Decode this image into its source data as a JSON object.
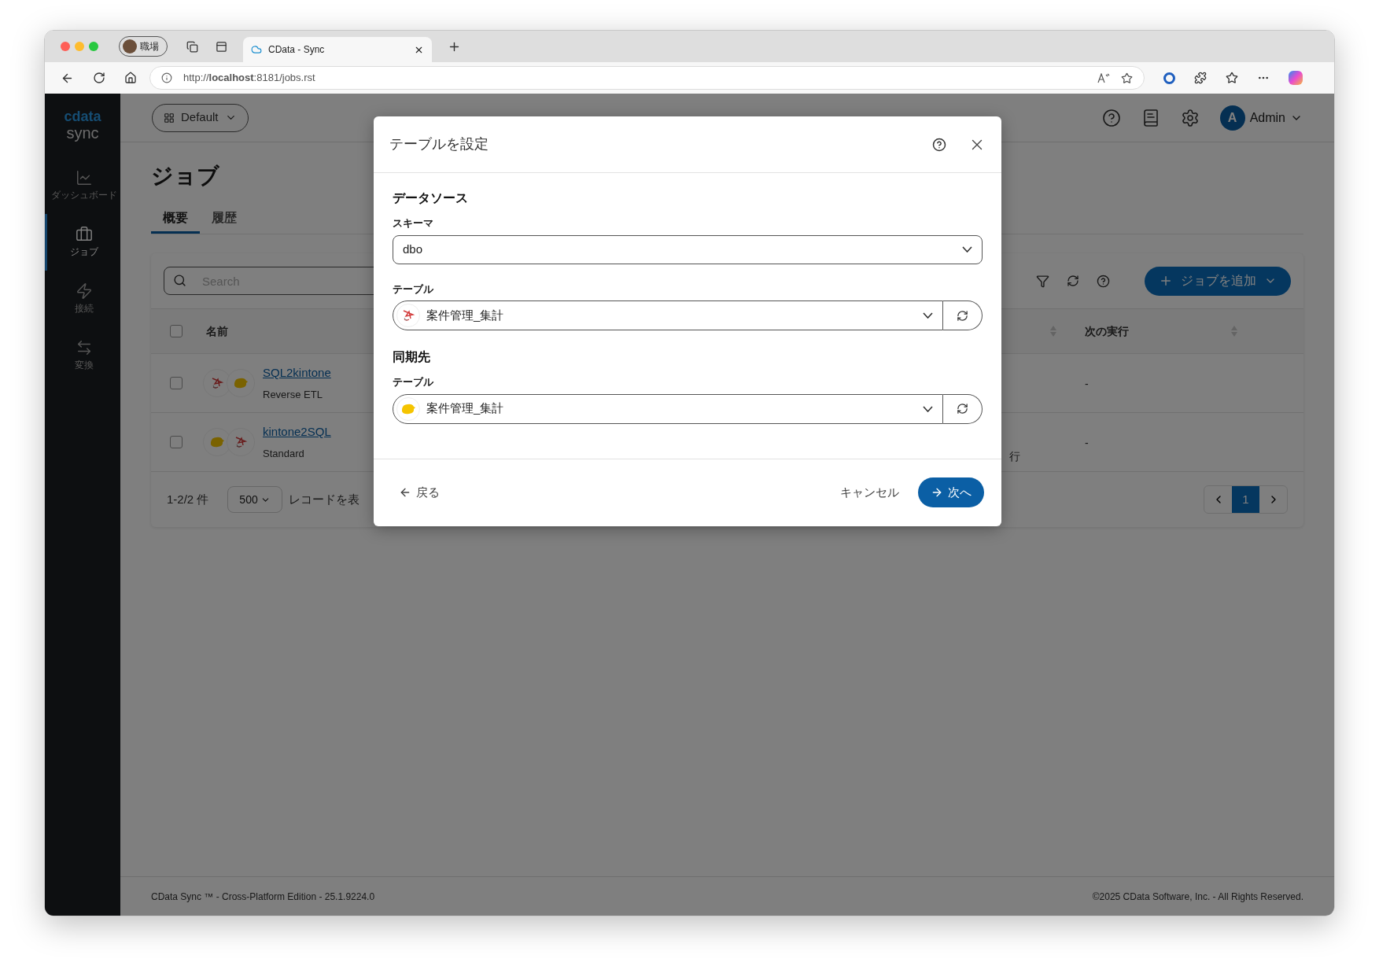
{
  "browser": {
    "profile": "職場",
    "tabs": [
      {
        "title": "CData - Sync",
        "selected": true
      }
    ],
    "url": "http://**localhost**:8181/jobs.rst"
  },
  "app": {
    "logo": {
      "brand": "cdata",
      "product": "sync"
    },
    "sidebar": {
      "items": [
        {
          "label": "ダッシュボード",
          "selected": false
        },
        {
          "label": "ジョブ",
          "selected": true
        },
        {
          "label": "接続",
          "selected": false
        },
        {
          "label": "変換",
          "selected": false
        }
      ]
    },
    "header": {
      "workspace": "Default",
      "user": {
        "initial": "A",
        "name": "Admin"
      }
    },
    "page": {
      "title": "ジョブ",
      "tabs": [
        {
          "label": "概要",
          "selected": true
        },
        {
          "label": "履歴",
          "selected": false
        }
      ],
      "search": {
        "placeholder": "Search"
      },
      "add_button": "ジョブを追加",
      "table": {
        "header_checked": false,
        "columns": [
          "名前",
          "次の実行"
        ],
        "rows": [
          {
            "checked": false,
            "connectors": [
              {
                "kind": "sqlserver"
              },
              {
                "kind": "kintone"
              }
            ],
            "name": "SQL2kintone",
            "type": "Reverse ETL",
            "next_run": "-"
          },
          {
            "checked": false,
            "connectors": [
              {
                "kind": "kintone"
              },
              {
                "kind": "sqlserver"
              }
            ],
            "name": "kintone2SQL",
            "type": "Standard",
            "column_3": "行",
            "next_run": "-"
          }
        ]
      },
      "pagination": {
        "summary": "1-2/2 件",
        "page_size": "500",
        "records_label": "レコードを表",
        "pages": [
          {
            "label": "1",
            "selected": true
          }
        ]
      }
    },
    "footer": {
      "left": "CData Sync ™ - Cross-Platform Edition - 25.1.9224.0",
      "right": "©2025 CData Software, Inc. - All Rights Reserved."
    }
  },
  "dialog": {
    "title": "テーブルを設定",
    "sections": [
      {
        "heading": "データソース",
        "fields": [
          {
            "kind": "select",
            "label": "スキーマ",
            "value": "dbo"
          },
          {
            "kind": "table_select",
            "label": "テーブル",
            "value": "案件管理_集計",
            "connector": {
              "kind": "sqlserver"
            }
          }
        ]
      },
      {
        "heading": "同期先",
        "fields": [
          {
            "kind": "table_select",
            "label": "テーブル",
            "value": "案件管理_集計",
            "connector": {
              "kind": "kintone"
            }
          }
        ]
      }
    ],
    "back": "戻る",
    "cancel": "キャンセル",
    "next": "次へ"
  }
}
